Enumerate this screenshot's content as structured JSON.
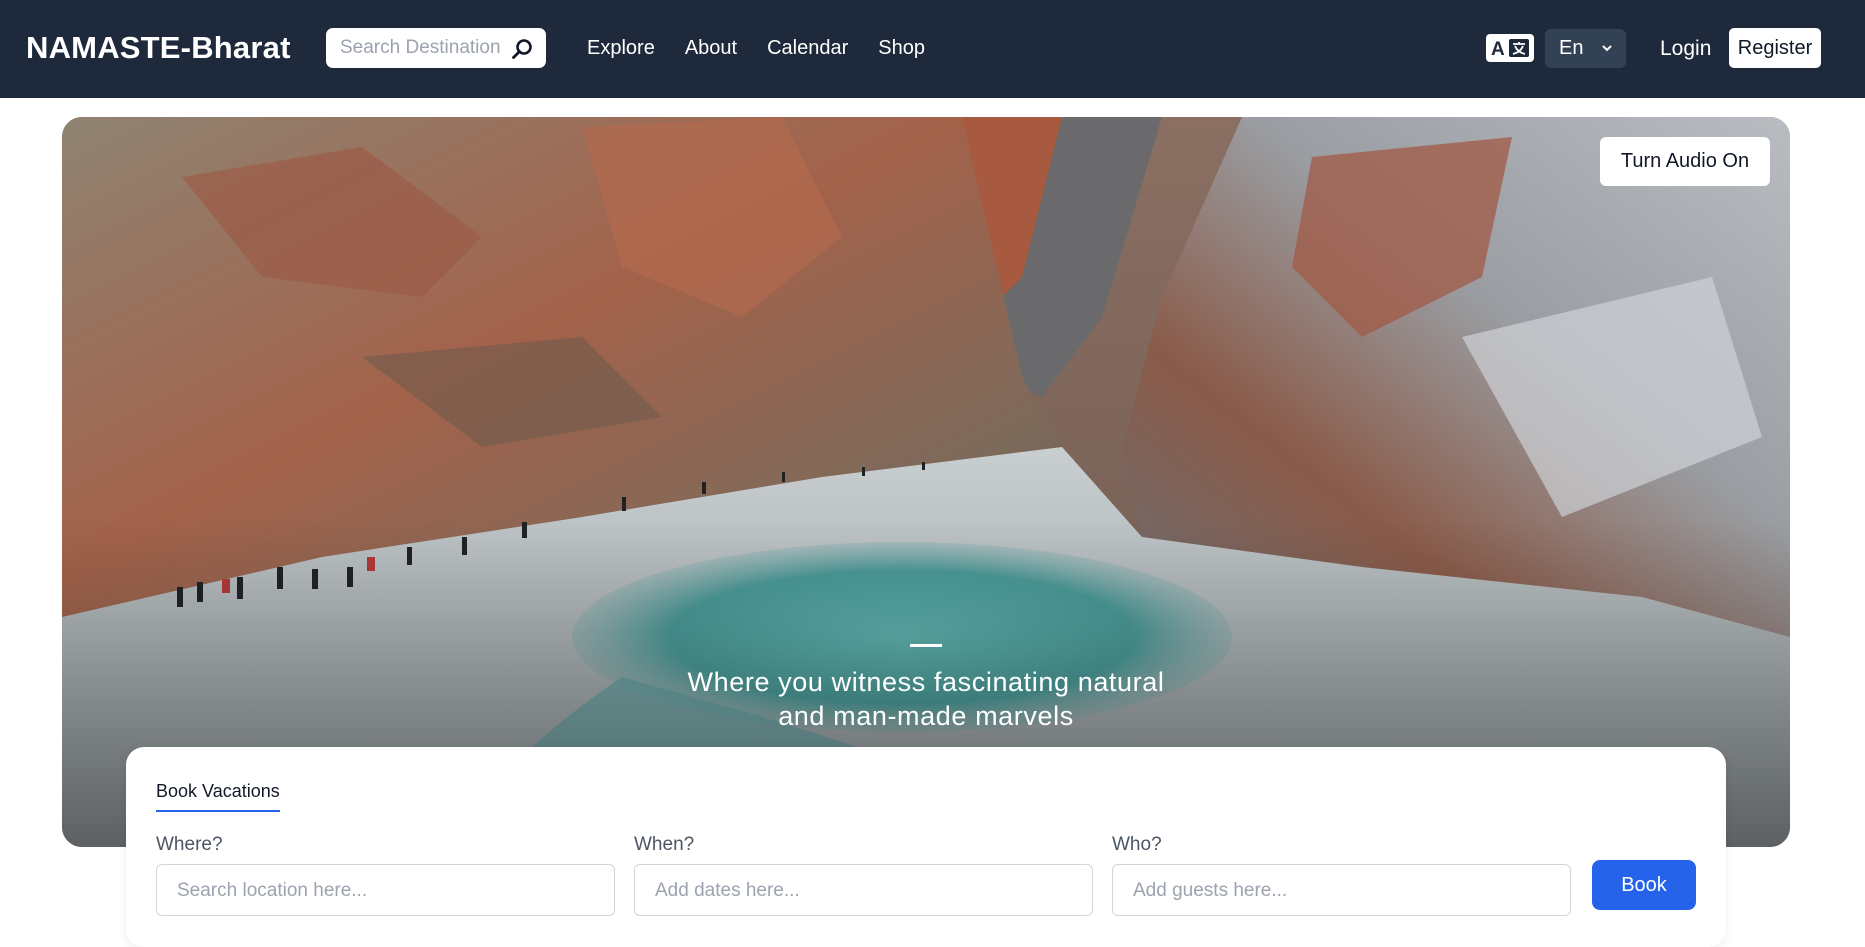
{
  "header": {
    "brand": "NAMASTE-Bharat",
    "search_placeholder": "Search Destination",
    "nav": [
      "Explore",
      "About",
      "Calendar",
      "Shop"
    ],
    "language": "En",
    "login": "Login",
    "register": "Register"
  },
  "hero": {
    "audio_button": "Turn Audio On",
    "tagline_line1": "Where you witness fascinating natural",
    "tagline_line2": "and man-made marvels"
  },
  "booking": {
    "tab": "Book Vacations",
    "where_label": "Where?",
    "where_placeholder": "Search location here...",
    "when_label": "When?",
    "when_placeholder": "Add dates here...",
    "who_label": "Who?",
    "who_placeholder": "Add guests here...",
    "book_button": "Book"
  },
  "colors": {
    "header_bg": "#1e293b",
    "accent": "#2563eb"
  },
  "icons": [
    "search-icon",
    "translate-icon",
    "chevron-down-icon"
  ]
}
